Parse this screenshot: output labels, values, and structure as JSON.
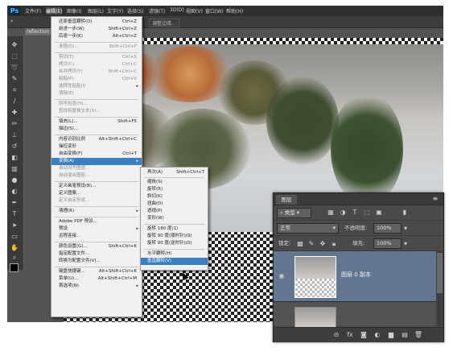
{
  "menubar": {
    "logo": "Ps",
    "items": [
      "文件(F)",
      "编辑(E)",
      "图像(I)",
      "图层(L)",
      "文字(Y)",
      "选择(S)",
      "滤镜(T)",
      "3D(D)",
      "视图(V)",
      "窗口(W)",
      "帮助(H)"
    ]
  },
  "optionsbar": {
    "button": "调整边缘..."
  },
  "document_tab": "reflection",
  "edit_menu": {
    "items": [
      {
        "label": "还原垂直翻转(O)",
        "shortcut": "Ctrl+Z",
        "disabled": false
      },
      {
        "label": "前进一步(W)",
        "shortcut": "Shift+Ctrl+Z",
        "disabled": false
      },
      {
        "label": "后退一步(K)",
        "shortcut": "Alt+Ctrl+Z",
        "disabled": false
      },
      {
        "label": "渐隐(D)...",
        "shortcut": "Shift+Ctrl+F",
        "disabled": true
      },
      {
        "label": "剪切(T)",
        "shortcut": "Ctrl+X",
        "disabled": true
      },
      {
        "label": "拷贝(C)",
        "shortcut": "Ctrl+C",
        "disabled": true
      },
      {
        "label": "合并拷贝(Y)",
        "shortcut": "Shift+Ctrl+C",
        "disabled": true
      },
      {
        "label": "粘贴(P)",
        "shortcut": "Ctrl+V",
        "disabled": true
      },
      {
        "label": "选择性粘贴(I)",
        "shortcut": "",
        "disabled": true
      },
      {
        "label": "清除(E)",
        "shortcut": "",
        "disabled": true
      },
      {
        "label": "拼写检查(H)...",
        "shortcut": "",
        "disabled": true
      },
      {
        "label": "查找和替换文本(X)...",
        "shortcut": "",
        "disabled": true
      },
      {
        "label": "填充(L)...",
        "shortcut": "Shift+F5",
        "disabled": false
      },
      {
        "label": "描边(S)...",
        "shortcut": "",
        "disabled": false
      },
      {
        "label": "内容识别比例",
        "shortcut": "Alt+Shift+Ctrl+C",
        "disabled": false
      },
      {
        "label": "操控变形",
        "shortcut": "",
        "disabled": false
      },
      {
        "label": "自由变换(F)",
        "shortcut": "Ctrl+T",
        "disabled": false
      },
      {
        "label": "变换(A)",
        "shortcut": "",
        "disabled": false
      },
      {
        "label": "自动对齐图层...",
        "shortcut": "",
        "disabled": true
      },
      {
        "label": "自动混合图层...",
        "shortcut": "",
        "disabled": true
      },
      {
        "label": "定义画笔预设(B)...",
        "shortcut": "",
        "disabled": false
      },
      {
        "label": "定义图案...",
        "shortcut": "",
        "disabled": false
      },
      {
        "label": "定义自定形状...",
        "shortcut": "",
        "disabled": true
      },
      {
        "label": "清理(R)",
        "shortcut": "",
        "disabled": false
      },
      {
        "label": "Adobe PDF 预设...",
        "shortcut": "",
        "disabled": false
      },
      {
        "label": "预设",
        "shortcut": "",
        "disabled": false
      },
      {
        "label": "远程连接...",
        "shortcut": "",
        "disabled": false
      },
      {
        "label": "颜色设置(G)...",
        "shortcut": "Shift+Ctrl+K",
        "disabled": false
      },
      {
        "label": "指定配置文件...",
        "shortcut": "",
        "disabled": false
      },
      {
        "label": "转换为配置文件(V)...",
        "shortcut": "",
        "disabled": false
      },
      {
        "label": "键盘快捷键...",
        "shortcut": "Alt+Shift+Ctrl+K",
        "disabled": false
      },
      {
        "label": "菜单(U)...",
        "shortcut": "Alt+Shift+Ctrl+M",
        "disabled": false
      },
      {
        "label": "首选项(N)",
        "shortcut": "",
        "disabled": false
      }
    ]
  },
  "transform_submenu": {
    "items": [
      {
        "label": "再次(A)",
        "shortcut": "Shift+Ctrl+T"
      },
      {
        "label": "缩放(S)",
        "shortcut": ""
      },
      {
        "label": "旋转(R)",
        "shortcut": ""
      },
      {
        "label": "斜切(K)",
        "shortcut": ""
      },
      {
        "label": "扭曲(D)",
        "shortcut": ""
      },
      {
        "label": "透视(P)",
        "shortcut": ""
      },
      {
        "label": "变形(W)",
        "shortcut": ""
      },
      {
        "label": "旋转 180 度(1)",
        "shortcut": ""
      },
      {
        "label": "旋转 90 度(顺时针)(9)",
        "shortcut": ""
      },
      {
        "label": "旋转 90 度(逆时针)(0)",
        "shortcut": ""
      },
      {
        "label": "水平翻转(H)",
        "shortcut": ""
      },
      {
        "label": "垂直翻转(V)",
        "shortcut": ""
      }
    ]
  },
  "layers_panel": {
    "tab": "图层",
    "filter_kind": "类型",
    "blend_mode": "正常",
    "opacity_label": "不透明度:",
    "opacity_value": "100%",
    "lock_label": "锁定:",
    "fill_label": "填充:",
    "fill_value": "100%",
    "layer_name": "图层 0 副本"
  },
  "colors": {
    "accent": "#3a7fc1",
    "panel": "#535353",
    "menu_bg": "#f0f0f0",
    "layer_selected": "#62778f"
  }
}
